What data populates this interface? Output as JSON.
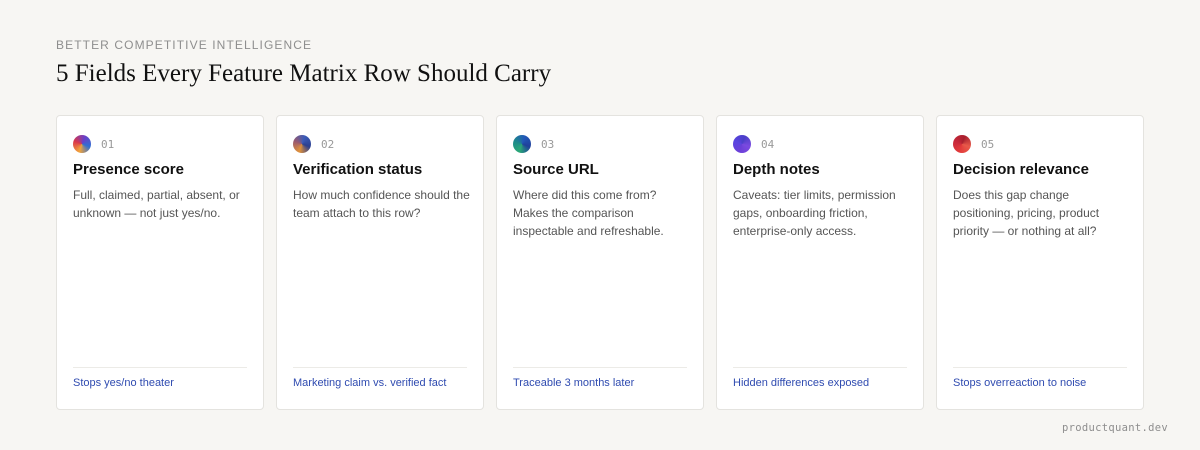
{
  "header": {
    "eyebrow": "BETTER COMPETITIVE INTELLIGENCE",
    "title": "5 Fields Every Feature Matrix Row Should Carry"
  },
  "cards": [
    {
      "number": "01",
      "title": "Presence score",
      "description": "Full, claimed, partial, absent, or unknown — not just yes/no.",
      "footer": "Stops yes/no theater",
      "icon": "color-dot-icon",
      "colors": [
        "#f2a33a",
        "#d9374b",
        "#6a3fc8",
        "#2f6fd1"
      ]
    },
    {
      "number": "02",
      "title": "Verification status",
      "description": "How much confidence should the team attach to this row?",
      "footer": "Marketing claim vs. verified fact",
      "icon": "color-dot-icon",
      "colors": [
        "#e0913a",
        "#9a5a6e",
        "#3b5bb8",
        "#2b3f8f"
      ]
    },
    {
      "number": "03",
      "title": "Source URL",
      "description": "Where did this come from? Makes the comparison inspectable and refreshable.",
      "footer": "Traceable 3 months later",
      "icon": "color-dot-icon",
      "colors": [
        "#2aa877",
        "#1d8a8a",
        "#2258b8",
        "#1f3f9a"
      ]
    },
    {
      "number": "04",
      "title": "Depth notes",
      "description": "Caveats: tier limits, permission gaps, onboarding friction, enterprise-only access.",
      "footer": "Hidden differences exposed",
      "icon": "color-dot-icon",
      "colors": [
        "#6b3fd8",
        "#5a44e0",
        "#4a3fc8",
        "#7b4ae0"
      ]
    },
    {
      "number": "05",
      "title": "Decision relevance",
      "description": "Does this gap change positioning, pricing, product priority — or nothing at all?",
      "footer": "Stops overreaction to noise",
      "icon": "color-dot-icon",
      "colors": [
        "#e23a3a",
        "#c8283a",
        "#a8202e",
        "#e85a4a"
      ]
    }
  ],
  "brand": "productquant.dev"
}
